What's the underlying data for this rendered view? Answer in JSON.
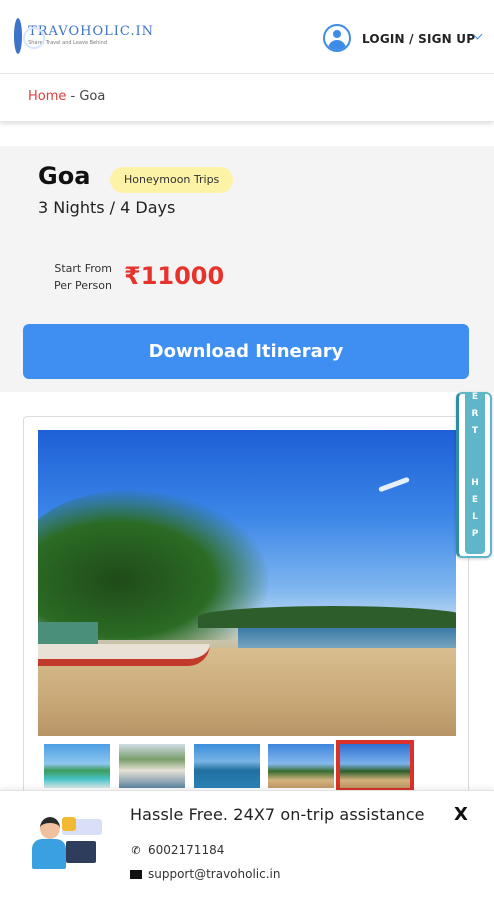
{
  "header": {
    "logo_title": "TRAVOHOLIC.IN",
    "logo_tagline": "Share, Travel and Leave Behind",
    "login_label": "LOGIN / SIGN UP"
  },
  "breadcrumb": {
    "home": "Home",
    "separator": " - ",
    "current": "Goa"
  },
  "trip": {
    "destination": "Goa",
    "tag": "Honeymoon Trips",
    "duration": "3 Nights / 4 Days",
    "start_label_line1": "Start From",
    "start_label_line2": "Per Person",
    "price": "₹11000",
    "download_label": "Download Itinerary"
  },
  "expert_tab": {
    "letters": [
      "E",
      "R",
      "T",
      "",
      "H",
      "E",
      "L",
      "P"
    ]
  },
  "gallery": {
    "thumbnails": 5,
    "active_index": 4
  },
  "support": {
    "title": "Hassle Free. 24X7 on-trip assistance",
    "phone": "6002171184",
    "email": "support@travoholic.in",
    "close_label": "X"
  },
  "colors": {
    "accent_blue": "#3f8ef2",
    "price_red": "#e8322c",
    "breadcrumb_red": "#e23d3d",
    "tag_yellow": "#fdf3a6",
    "expert_teal": "#5fb6c9"
  }
}
